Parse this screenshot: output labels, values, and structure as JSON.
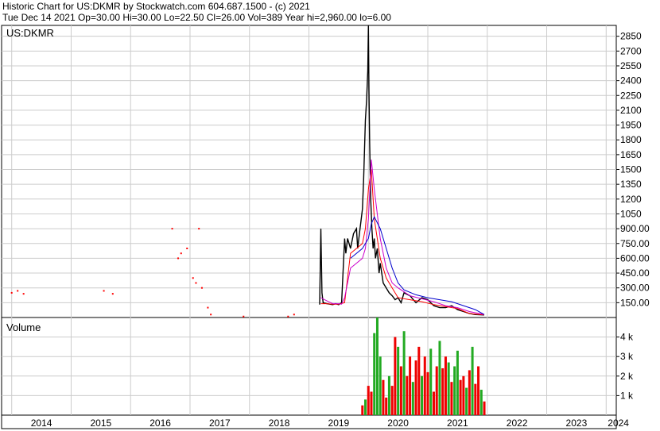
{
  "header": {
    "line1": "Historic Chart for US:DKMR by Stockwatch.com 604.687.1500 - (c) 2021",
    "line2": "Tue Dec 14 2021  Op=30.00  Hi=30.00  Lo=22.50  Cl=26.00  Vol=389  Year hi=2,960.00  lo=6.00"
  },
  "colors": {
    "price": "#000000",
    "ma_short": "#ff0000",
    "ma_mid": "#cc00cc",
    "ma_long": "#0000cc",
    "vol_up": "#22aa22",
    "vol_down": "#ee0000",
    "grid": "#cccccc"
  },
  "chart_data": [
    {
      "type": "line",
      "title": "US:DKMR",
      "ylim": [
        0,
        2960
      ],
      "xlim": [
        2013.83,
        2024.17
      ],
      "y_ticks": [
        150,
        300,
        450,
        600,
        750,
        900,
        1050,
        1200,
        1350,
        1500,
        1650,
        1800,
        1950,
        2100,
        2250,
        2400,
        2550,
        2700,
        2850
      ],
      "y_tick_labels": [
        "150.00",
        "300.00",
        "450.00",
        "600.00",
        "750.00",
        "900.00",
        "1050",
        "1200",
        "1350",
        "1500",
        "1650",
        "1800",
        "1950",
        "2100",
        "2250",
        "2400",
        "2550",
        "2700",
        "2850"
      ],
      "series": [
        {
          "x": [
            2019.18,
            2019.2,
            2019.22,
            2019.24,
            2019.3,
            2019.4,
            2019.45,
            2019.5,
            2019.55,
            2019.6,
            2019.62,
            2019.65,
            2019.7,
            2019.75,
            2019.8,
            2019.82,
            2019.85,
            2019.88,
            2019.9,
            2019.92,
            2019.95,
            2019.97,
            2019.99,
            2020.0,
            2020.01,
            2020.02,
            2020.04,
            2020.06,
            2020.08,
            2020.1,
            2020.12,
            2020.15,
            2020.18,
            2020.2,
            2020.25,
            2020.3,
            2020.35,
            2020.4,
            2020.45,
            2020.5,
            2020.55,
            2020.6,
            2020.7,
            2020.8,
            2020.9,
            2021.0,
            2021.1,
            2021.2,
            2021.3,
            2021.4,
            2021.5,
            2021.6,
            2021.7,
            2021.8,
            2021.95
          ],
          "y": [
            130,
            900,
            250,
            150,
            140,
            130,
            140,
            130,
            150,
            800,
            650,
            800,
            700,
            850,
            900,
            700,
            850,
            1000,
            1100,
            1400,
            2000,
            2200,
            2500,
            2960,
            2300,
            1800,
            1200,
            900,
            700,
            800,
            600,
            700,
            450,
            550,
            350,
            300,
            250,
            220,
            180,
            200,
            150,
            250,
            220,
            150,
            200,
            180,
            120,
            100,
            100,
            120,
            80,
            60,
            40,
            30,
            26
          ]
        },
        {
          "name": "",
          "x": [
            2019.2,
            2019.3,
            2019.4,
            2019.5,
            2019.6,
            2019.7,
            2019.8,
            2019.9,
            2019.95,
            2020.0,
            2020.05,
            2020.1,
            2020.2,
            2020.3,
            2020.4,
            2020.5,
            2020.7,
            2020.9,
            2021.1,
            2021.3,
            2021.5,
            2021.7,
            2021.95
          ],
          "y": [
            140,
            140,
            135,
            135,
            150,
            650,
            700,
            750,
            900,
            1300,
            1500,
            1000,
            600,
            400,
            300,
            200,
            180,
            160,
            130,
            110,
            90,
            40,
            26
          ]
        },
        {
          "name": "",
          "x": [
            2019.2,
            2019.3,
            2019.4,
            2019.5,
            2019.55,
            2019.6,
            2019.65,
            2019.7,
            2019.8,
            2019.9,
            2019.95,
            2020.0,
            2020.05,
            2020.1,
            2020.2,
            2020.3,
            2020.4,
            2020.5,
            2020.7,
            2020.9,
            2021.1,
            2021.3,
            2021.5,
            2021.7,
            2021.95
          ],
          "y": [
            200,
            170,
            140,
            140,
            135,
            200,
            350,
            500,
            550,
            600,
            700,
            1000,
            1600,
            1300,
            800,
            500,
            350,
            300,
            220,
            190,
            160,
            120,
            100,
            60,
            30
          ]
        },
        {
          "name": "",
          "x": [
            2019.7,
            2019.9,
            2020.0,
            2020.05,
            2020.1,
            2020.2,
            2020.3,
            2020.4,
            2020.5,
            2020.6,
            2020.8,
            2021.0,
            2021.2,
            2021.4,
            2021.6,
            2021.8,
            2021.95
          ],
          "y": [
            600,
            700,
            800,
            950,
            1020,
            900,
            700,
            500,
            350,
            280,
            230,
            200,
            180,
            160,
            120,
            80,
            30
          ]
        }
      ],
      "scatter": {
        "x": [
          2014.0,
          2014.1,
          2014.2,
          2015.55,
          2015.7,
          2016.7,
          2016.8,
          2016.85,
          2016.95,
          2017.05,
          2017.1,
          2017.15,
          2017.2,
          2017.3,
          2017.35,
          2017.9,
          2018.65,
          2018.75
        ],
        "y": [
          250,
          270,
          240,
          270,
          240,
          900,
          600,
          650,
          700,
          400,
          350,
          900,
          300,
          100,
          30,
          10,
          10,
          30
        ]
      }
    },
    {
      "type": "bar",
      "title": "Volume",
      "ylim": [
        0,
        5000
      ],
      "y_ticks": [
        1000,
        2000,
        3000,
        4000
      ],
      "y_tick_labels": [
        "1 k",
        "2 k",
        "3 k",
        "4 k"
      ],
      "x_ticks": [
        2014,
        2015,
        2016,
        2017,
        2018,
        2019,
        2020,
        2021,
        2022,
        2023,
        2024
      ],
      "x_tick_labels": [
        "2014",
        "2015",
        "2016",
        "2017",
        "2018",
        "2019",
        "2020",
        "2021",
        "2022",
        "2023",
        "2024"
      ],
      "x": [
        2019.9,
        2019.95,
        2020.0,
        2020.05,
        2020.1,
        2020.15,
        2020.2,
        2020.25,
        2020.3,
        2020.35,
        2020.4,
        2020.45,
        2020.5,
        2020.55,
        2020.6,
        2020.65,
        2020.7,
        2020.75,
        2020.8,
        2020.85,
        2020.9,
        2020.95,
        2021.0,
        2021.05,
        2021.1,
        2021.15,
        2021.2,
        2021.25,
        2021.3,
        2021.35,
        2021.4,
        2021.45,
        2021.5,
        2021.55,
        2021.6,
        2021.65,
        2021.7,
        2021.75,
        2021.8,
        2021.85,
        2021.9,
        2021.95
      ],
      "values": [
        500,
        800,
        1500,
        1200,
        4200,
        5000,
        3000,
        1800,
        900,
        2000,
        1500,
        4000,
        3500,
        2500,
        4300,
        2000,
        3000,
        1700,
        2800,
        3500,
        2000,
        3000,
        2200,
        3400,
        1200,
        2500,
        3800,
        2400,
        3000,
        2700,
        1700,
        2500,
        3300,
        1800,
        2000,
        1400,
        2300,
        3500,
        1600,
        2500,
        1300,
        700
      ],
      "up": [
        false,
        true,
        false,
        false,
        true,
        true,
        true,
        false,
        false,
        true,
        false,
        false,
        true,
        false,
        true,
        false,
        false,
        true,
        false,
        false,
        true,
        false,
        false,
        true,
        false,
        false,
        true,
        false,
        false,
        true,
        false,
        true,
        true,
        false,
        false,
        true,
        false,
        true,
        false,
        false,
        true,
        false
      ]
    }
  ]
}
